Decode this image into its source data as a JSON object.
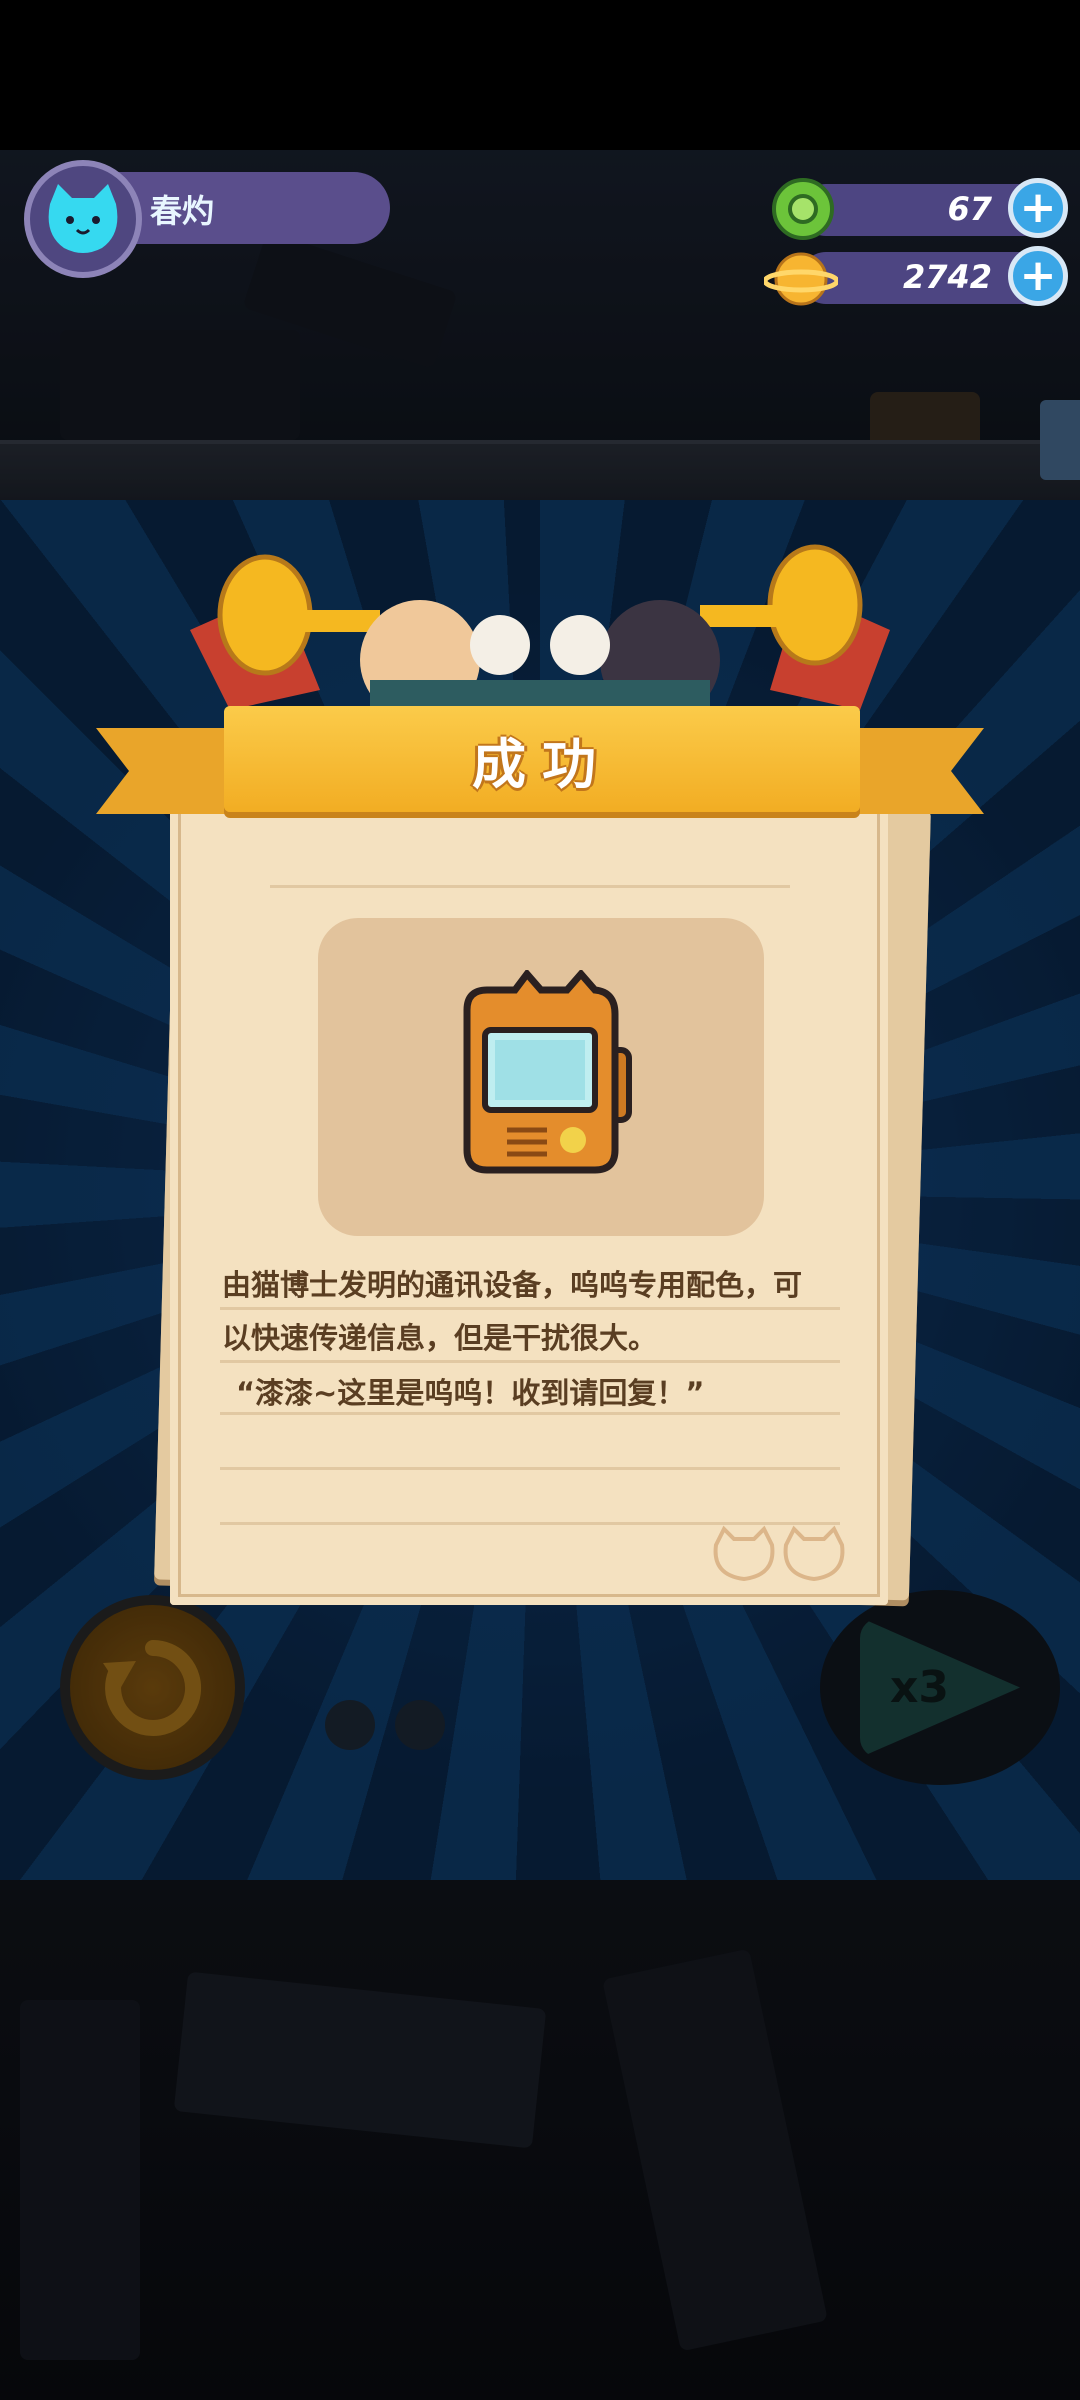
{
  "player": {
    "name": "春灼"
  },
  "currencies": [
    {
      "icon": "green-gem-icon",
      "value": "67"
    },
    {
      "icon": "planet-coin-icon",
      "value": "2742"
    }
  ],
  "dialog": {
    "title": "成功",
    "item_icon": "walkie-talkie-icon",
    "description_lines": [
      "由猫博士发明的通讯设备，呜呜专用配色，可",
      "以快速传递信息，但是干扰很大。",
      "“漆漆~这里是呜呜！收到请回复！”"
    ]
  },
  "controls": {
    "speed_label": "x3"
  },
  "colors": {
    "banner": "#f2ad23",
    "paper": "#f4e1c0",
    "text": "#5a3e22",
    "bar": "#5a4e8c"
  }
}
